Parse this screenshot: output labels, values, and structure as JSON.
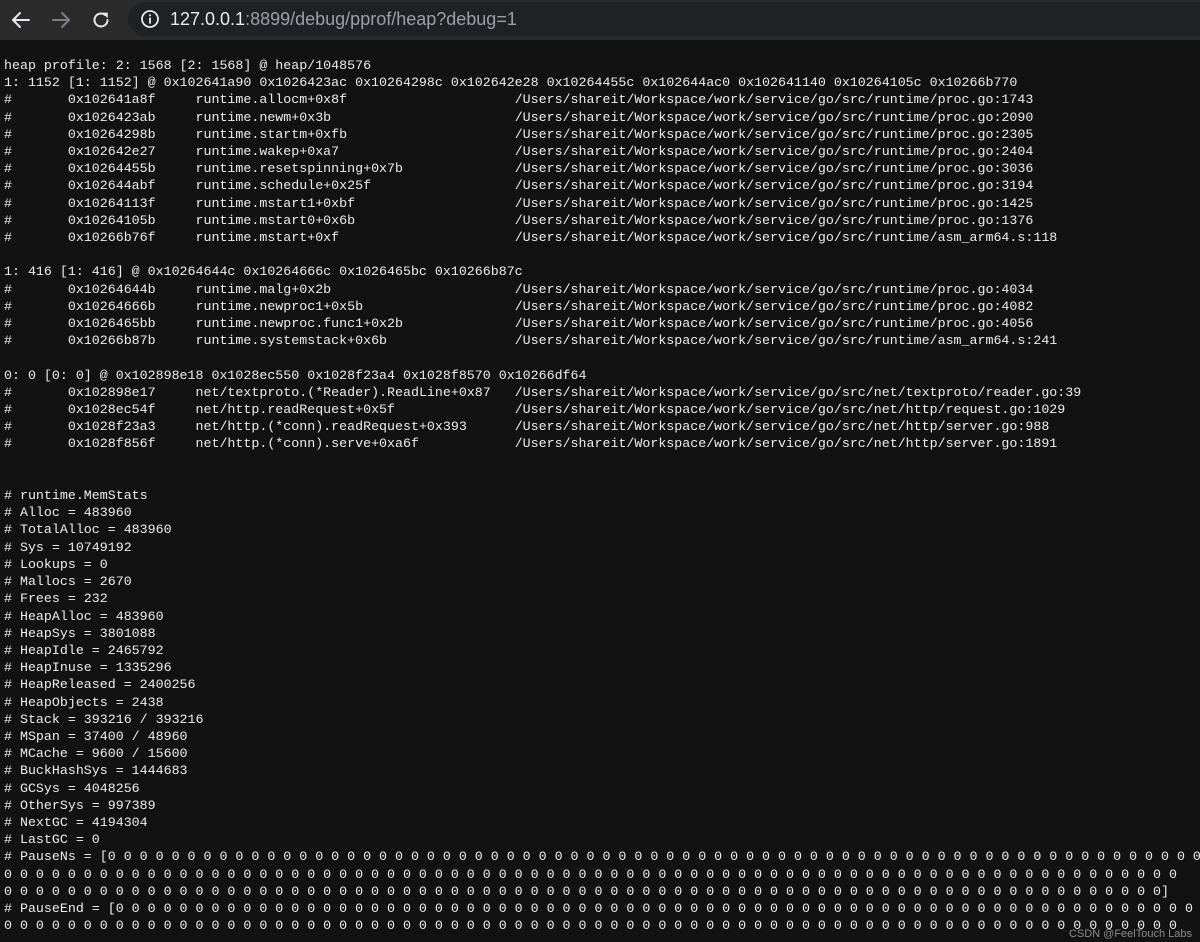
{
  "browser": {
    "url_host": "127.0.0.1",
    "url_rest": ":8899/debug/pprof/heap?debug=1"
  },
  "icons": {
    "back": "back-arrow-icon",
    "forward": "forward-arrow-icon",
    "reload": "reload-icon",
    "info": "info-icon"
  },
  "page": {
    "text": "heap profile: 2: 1568 [2: 1568] @ heap/1048576\n1: 1152 [1: 1152] @ 0x102641a90 0x1026423ac 0x10264298c 0x102642e28 0x10264455c 0x102644ac0 0x102641140 0x10264105c 0x10266b770\n#\t0x102641a8f\truntime.allocm+0x8f\t\t\t/Users/shareit/Workspace/work/service/go/src/runtime/proc.go:1743\n#\t0x1026423ab\truntime.newm+0x3b\t\t\t/Users/shareit/Workspace/work/service/go/src/runtime/proc.go:2090\n#\t0x10264298b\truntime.startm+0xfb\t\t\t/Users/shareit/Workspace/work/service/go/src/runtime/proc.go:2305\n#\t0x102642e27\truntime.wakep+0xa7\t\t\t/Users/shareit/Workspace/work/service/go/src/runtime/proc.go:2404\n#\t0x10264455b\truntime.resetspinning+0x7b\t\t/Users/shareit/Workspace/work/service/go/src/runtime/proc.go:3036\n#\t0x102644abf\truntime.schedule+0x25f\t\t\t/Users/shareit/Workspace/work/service/go/src/runtime/proc.go:3194\n#\t0x10264113f\truntime.mstart1+0xbf\t\t\t/Users/shareit/Workspace/work/service/go/src/runtime/proc.go:1425\n#\t0x10264105b\truntime.mstart0+0x6b\t\t\t/Users/shareit/Workspace/work/service/go/src/runtime/proc.go:1376\n#\t0x10266b76f\truntime.mstart+0xf\t\t\t/Users/shareit/Workspace/work/service/go/src/runtime/asm_arm64.s:118\n\n1: 416 [1: 416] @ 0x10264644c 0x10264666c 0x1026465bc 0x10266b87c\n#\t0x10264644b\truntime.malg+0x2b\t\t\t/Users/shareit/Workspace/work/service/go/src/runtime/proc.go:4034\n#\t0x10264666b\truntime.newproc1+0x5b\t\t\t/Users/shareit/Workspace/work/service/go/src/runtime/proc.go:4082\n#\t0x1026465bb\truntime.newproc.func1+0x2b\t\t/Users/shareit/Workspace/work/service/go/src/runtime/proc.go:4056\n#\t0x10266b87b\truntime.systemstack+0x6b\t\t/Users/shareit/Workspace/work/service/go/src/runtime/asm_arm64.s:241\n\n0: 0 [0: 0] @ 0x102898e18 0x1028ec550 0x1028f23a4 0x1028f8570 0x10266df64\n#\t0x102898e17\tnet/textproto.(*Reader).ReadLine+0x87\t/Users/shareit/Workspace/work/service/go/src/net/textproto/reader.go:39\n#\t0x1028ec54f\tnet/http.readRequest+0x5f\t\t/Users/shareit/Workspace/work/service/go/src/net/http/request.go:1029\n#\t0x1028f23a3\tnet/http.(*conn).readRequest+0x393\t/Users/shareit/Workspace/work/service/go/src/net/http/server.go:988\n#\t0x1028f856f\tnet/http.(*conn).serve+0xa6f\t\t/Users/shareit/Workspace/work/service/go/src/net/http/server.go:1891\n\n\n# runtime.MemStats\n# Alloc = 483960\n# TotalAlloc = 483960\n# Sys = 10749192\n# Lookups = 0\n# Mallocs = 2670\n# Frees = 232\n# HeapAlloc = 483960\n# HeapSys = 3801088\n# HeapIdle = 2465792\n# HeapInuse = 1335296\n# HeapReleased = 2400256\n# HeapObjects = 2438\n# Stack = 393216 / 393216\n# MSpan = 37400 / 48960\n# MCache = 9600 / 15600\n# BuckHashSys = 1444683\n# GCSys = 4048256\n# OtherSys = 997389\n# NextGC = 4194304\n# LastGC = 0\n# PauseNs = [0 0 0 0 0 0 0 0 0 0 0 0 0 0 0 0 0 0 0 0 0 0 0 0 0 0 0 0 0 0 0 0 0 0 0 0 0 0 0 0 0 0 0 0 0 0 0 0 0 0 0 0 0 0 0 0 0 0 0 0 0 0 0 0 0 0 0 0 0 0 0 0 0 0\n0 0 0 0 0 0 0 0 0 0 0 0 0 0 0 0 0 0 0 0 0 0 0 0 0 0 0 0 0 0 0 0 0 0 0 0 0 0 0 0 0 0 0 0 0 0 0 0 0 0 0 0 0 0 0 0 0 0 0 0 0 0 0 0 0 0 0 0 0 0 0 0 0 0\n0 0 0 0 0 0 0 0 0 0 0 0 0 0 0 0 0 0 0 0 0 0 0 0 0 0 0 0 0 0 0 0 0 0 0 0 0 0 0 0 0 0 0 0 0 0 0 0 0 0 0 0 0 0 0 0 0 0 0 0 0 0 0 0 0 0 0 0 0 0 0 0 0]\n# PauseEnd = [0 0 0 0 0 0 0 0 0 0 0 0 0 0 0 0 0 0 0 0 0 0 0 0 0 0 0 0 0 0 0 0 0 0 0 0 0 0 0 0 0 0 0 0 0 0 0 0 0 0 0 0 0 0 0 0 0 0 0 0 0 0 0 0 0 0 0 0 0 0 0 0 0 0\n0 0 0 0 0 0 0 0 0 0 0 0 0 0 0 0 0 0 0 0 0 0 0 0 0 0 0 0 0 0 0 0 0 0 0 0 0 0 0 0 0 0 0 0 0 0 0 0 0 0 0 0 0 0 0 0 0 0 0 0 0 0 0 0 0 0 0 0 0 0 0 0 0 0"
  },
  "watermark": "CSDN @FeelTouch Labs"
}
